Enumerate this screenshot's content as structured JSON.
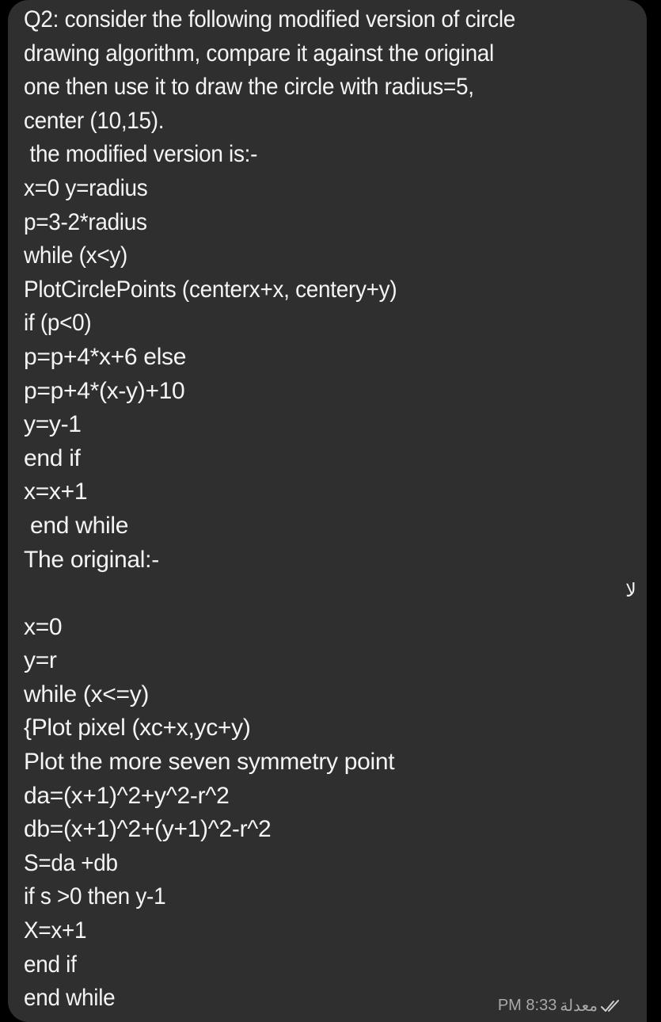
{
  "message": {
    "lines": [
      "Q2: consider the following modified version of circle",
      "drawing algorithm, compare it against the original",
      "one then use it to draw the circle with radius=5,",
      "center (10,15).",
      " the modified version is:-",
      "x=0 y=radius",
      "p=3-2*radius",
      "while (x<y)",
      "PlotCirclePoints (centerx+x, centery+y)",
      "if (p<0)",
      "p=p+4*x+6 else",
      "p=p+4*(x-y)+10",
      "y=y-1",
      "end if",
      "x=x+1",
      " end while",
      "The original:-",
      "",
      "x=0",
      "y=r",
      "while (x<=y)",
      "{Plot pixel (xc+x,yc+y)",
      "Plot the more seven symmetry point",
      "da=(x+1)^2+y^2-r^2",
      "db=(x+1)^2+(y+1)^2-r^2",
      "S=da +db",
      "if s >0 then y-1",
      "X=x+1",
      "end if",
      "end while"
    ],
    "translate_icon": "لا",
    "time": "PM 8:33",
    "edited_label": "معدلة",
    "read_status_icon": "double-check-icon"
  },
  "colors": {
    "bubble": "#2f2f2f",
    "background": "#000000",
    "text": "#f4f4f4",
    "meta": "#a9a9a9"
  }
}
